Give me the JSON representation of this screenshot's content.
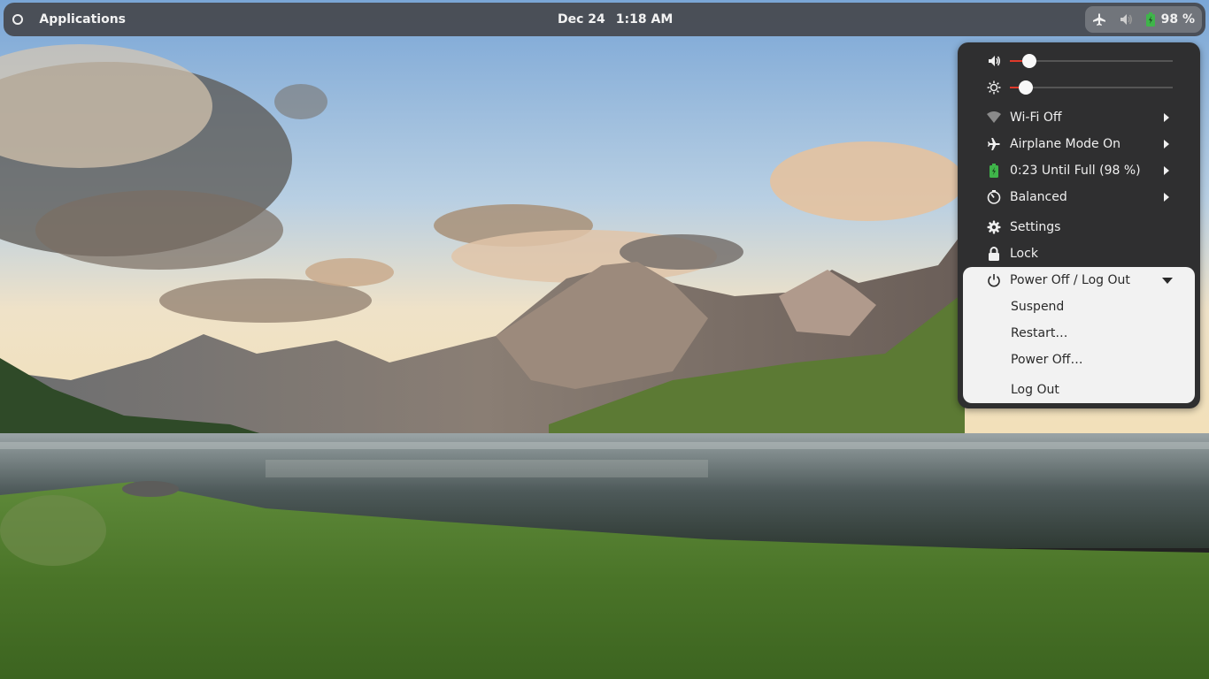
{
  "topbar": {
    "activities_label": "Applications",
    "date": "Dec 24",
    "time": "1:18 AM",
    "battery_percent": "98 %",
    "icons": [
      "airplane-icon",
      "volume-icon",
      "battery-icon"
    ]
  },
  "sysmenu": {
    "volume_level": 0.12,
    "brightness_level": 0.1,
    "items": {
      "wifi": "Wi-Fi Off",
      "airplane": "Airplane Mode On",
      "battery": "0:23 Until Full (98 %)",
      "power_mode": "Balanced",
      "settings": "Settings",
      "lock": "Lock",
      "power": "Power Off / Log Out"
    },
    "power_submenu": [
      "Suspend",
      "Restart…",
      "Power Off…",
      "Log Out"
    ]
  },
  "colors": {
    "accent": "#e0392a",
    "battery_green": "#3fb44a",
    "menu_bg": "#2f2f30",
    "submenu_bg": "#f2f2f2"
  }
}
